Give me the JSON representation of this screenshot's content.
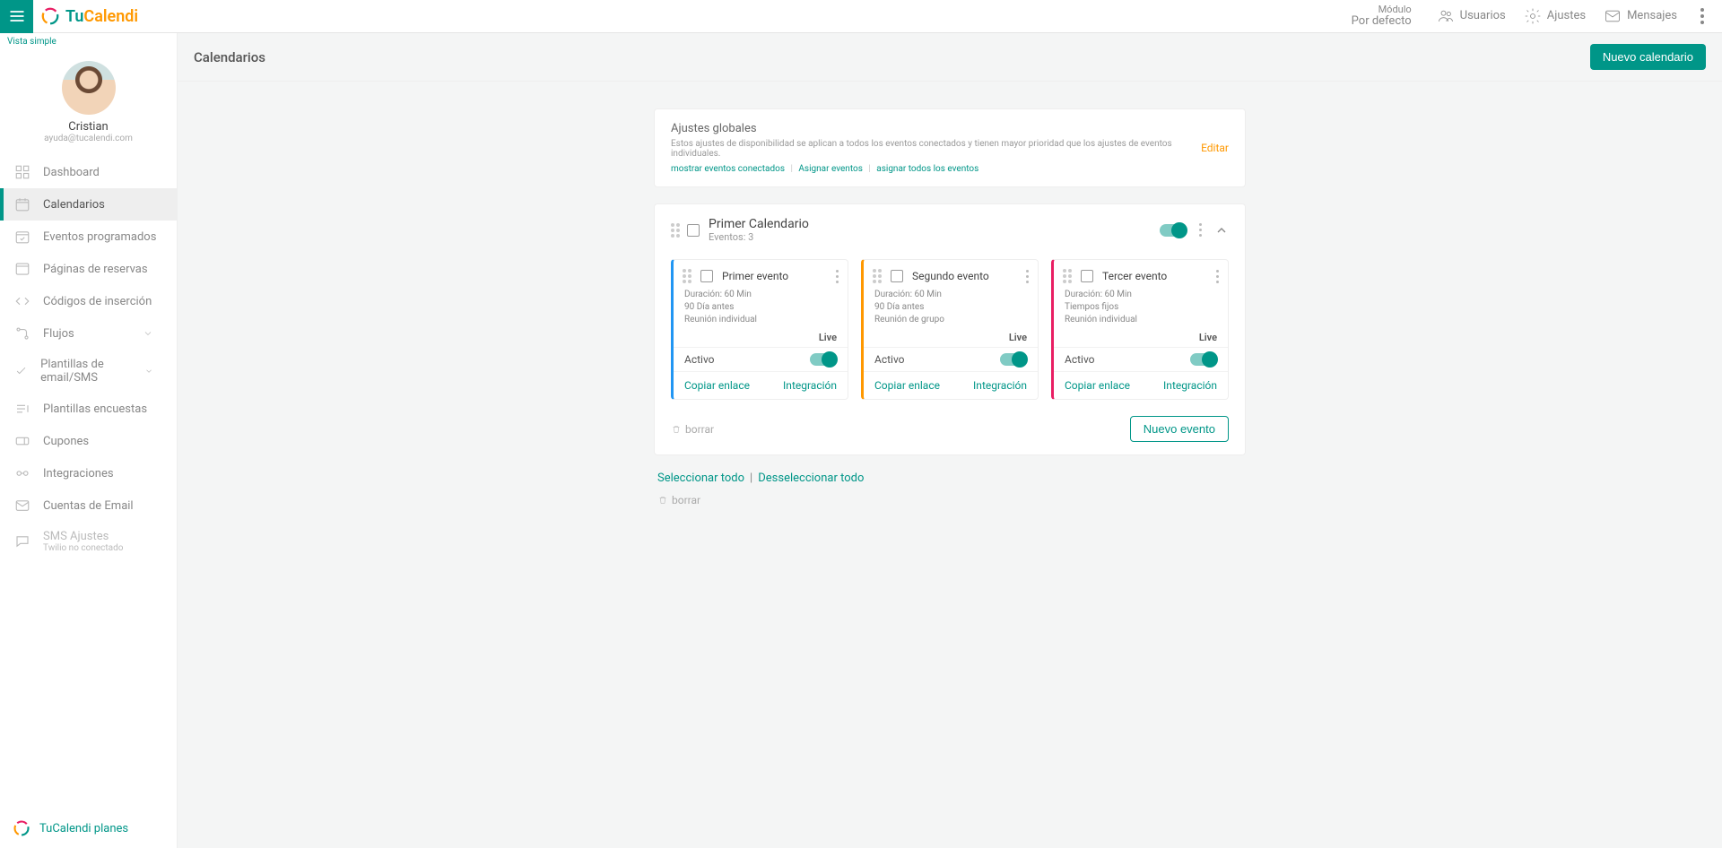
{
  "header": {
    "brand": "TuCalendi",
    "module_title": "Módulo",
    "module_value": "Por defecto",
    "links": {
      "users": "Usuarios",
      "settings": "Ajustes",
      "messages": "Mensajes"
    }
  },
  "sidebar": {
    "vista_simple": "Vista simple",
    "user_name": "Cristian",
    "user_email": "ayuda@tucalendi.com",
    "items": [
      {
        "label": "Dashboard"
      },
      {
        "label": "Calendarios"
      },
      {
        "label": "Eventos programados"
      },
      {
        "label": "Páginas de reservas"
      },
      {
        "label": "Códigos de inserción"
      },
      {
        "label": "Flujos"
      },
      {
        "label": "Plantillas de email/SMS"
      },
      {
        "label": "Plantillas encuestas"
      },
      {
        "label": "Cupones"
      },
      {
        "label": "Integraciones"
      },
      {
        "label": "Cuentas de Email"
      },
      {
        "label": "SMS Ajustes",
        "sub": "Twilio no conectado"
      }
    ],
    "planes": "TuCalendi planes"
  },
  "page": {
    "title": "Calendarios",
    "new_calendar": "Nuevo calendario",
    "global": {
      "title": "Ajustes globales",
      "desc": "Estos ajustes de disponibilidad se aplican a todos los eventos conectados y tienen mayor prioridad que los ajustes de eventos individuales.",
      "link1": "mostrar eventos conectados",
      "link2": "Asignar eventos",
      "link3": "asignar todos los eventos",
      "edit": "Editar"
    },
    "calendar": {
      "name": "Primer Calendario",
      "meta": "Eventos: 3",
      "new_event": "Nuevo evento"
    },
    "events": [
      {
        "name": "Primer evento",
        "d0": "Duración: 60 Min",
        "d1": "90 Día antes",
        "d2": "Reunión individual"
      },
      {
        "name": "Segundo evento",
        "d0": "Duración: 60 Min",
        "d1": "90 Día antes",
        "d2": "Reunión de grupo"
      },
      {
        "name": "Tercer evento",
        "d0": "Duración: 60 Min",
        "d1": "Tiempos fijos",
        "d2": "Reunión individual"
      }
    ],
    "ev_common": {
      "live": "Live",
      "activo": "Activo",
      "copy": "Copiar enlace",
      "integration": "Integración"
    },
    "borrar": "borrar",
    "select_all": "Seleccionar todo",
    "deselect_all": "Desseleccionar todo"
  }
}
